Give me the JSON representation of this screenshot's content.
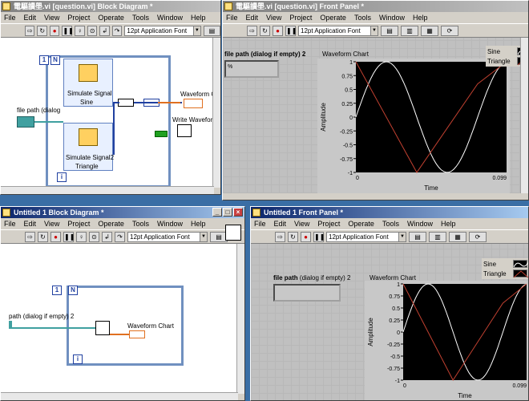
{
  "menu_items": [
    "File",
    "Edit",
    "View",
    "Project",
    "Operate",
    "Tools",
    "Window",
    "Help"
  ],
  "font_selector": "12pt Application Font",
  "win_bd_top": {
    "title": "電驅讀壆.vi [question.vi] Block Diagram *",
    "loop_n": "N",
    "loop_i": "i",
    "node1_label": "Simulate Signal",
    "node1_sub": "Sine",
    "node2_label": "Simulate Signal2",
    "node2_sub": "Triangle",
    "file_path_label": "file path (dialog",
    "chart_label": "Waveform Chart",
    "write_label": "Write Waveforms"
  },
  "win_fp_top": {
    "title": "電驅讀壆.vi [question.vi] Front Panel *",
    "file_path_label": "file path (dialog if empty) 2",
    "file_path_value": "%",
    "chart_title": "Waveform Chart"
  },
  "win_bd_bottom": {
    "title": "Untitled 1 Block Diagram *",
    "loop_n": "N",
    "loop_i": "i",
    "path_label": "path (dialog if empty) 2",
    "chart_label": "Waveform Chart"
  },
  "win_fp_bottom": {
    "title": "Untitled 1 Front Panel *",
    "file_path_label_bold": "file path",
    "file_path_label_rest": "(dialog if empty) 2",
    "chart_title": "Waveform Chart"
  },
  "chart_data": {
    "type": "line",
    "xlabel": "Time",
    "ylabel": "Amplitude",
    "xlim": [
      0,
      0.099
    ],
    "ylim": [
      -1,
      1
    ],
    "x_ticks": [
      "0",
      "0.099"
    ],
    "y_ticks": [
      "1",
      "0.75",
      "0.5",
      "0.25",
      "0",
      "-0.25",
      "-0.5",
      "-0.75",
      "-1"
    ],
    "series": [
      {
        "name": "Sine",
        "color": "#ffffff",
        "x": [
          0,
          0.01,
          0.02,
          0.03,
          0.04,
          0.05,
          0.06,
          0.07,
          0.08,
          0.09,
          0.099
        ],
        "values": [
          0,
          0.71,
          1,
          0.71,
          0,
          -0.71,
          -1,
          -0.71,
          0,
          0.71,
          0.99
        ]
      },
      {
        "name": "Triangle",
        "color": "#c04030",
        "x": [
          0,
          0.02,
          0.04,
          0.06,
          0.08,
          0.099
        ],
        "values": [
          1,
          0,
          -1,
          -0.2,
          0.6,
          1
        ]
      }
    ],
    "legend_position": "top-right"
  },
  "colors": {
    "titlebar_active": "#0a246a",
    "panel_grid": "#c0c0c0",
    "plot_bg": "#000000",
    "wire_orange": "#e07020",
    "wire_blue": "#2040a0"
  }
}
